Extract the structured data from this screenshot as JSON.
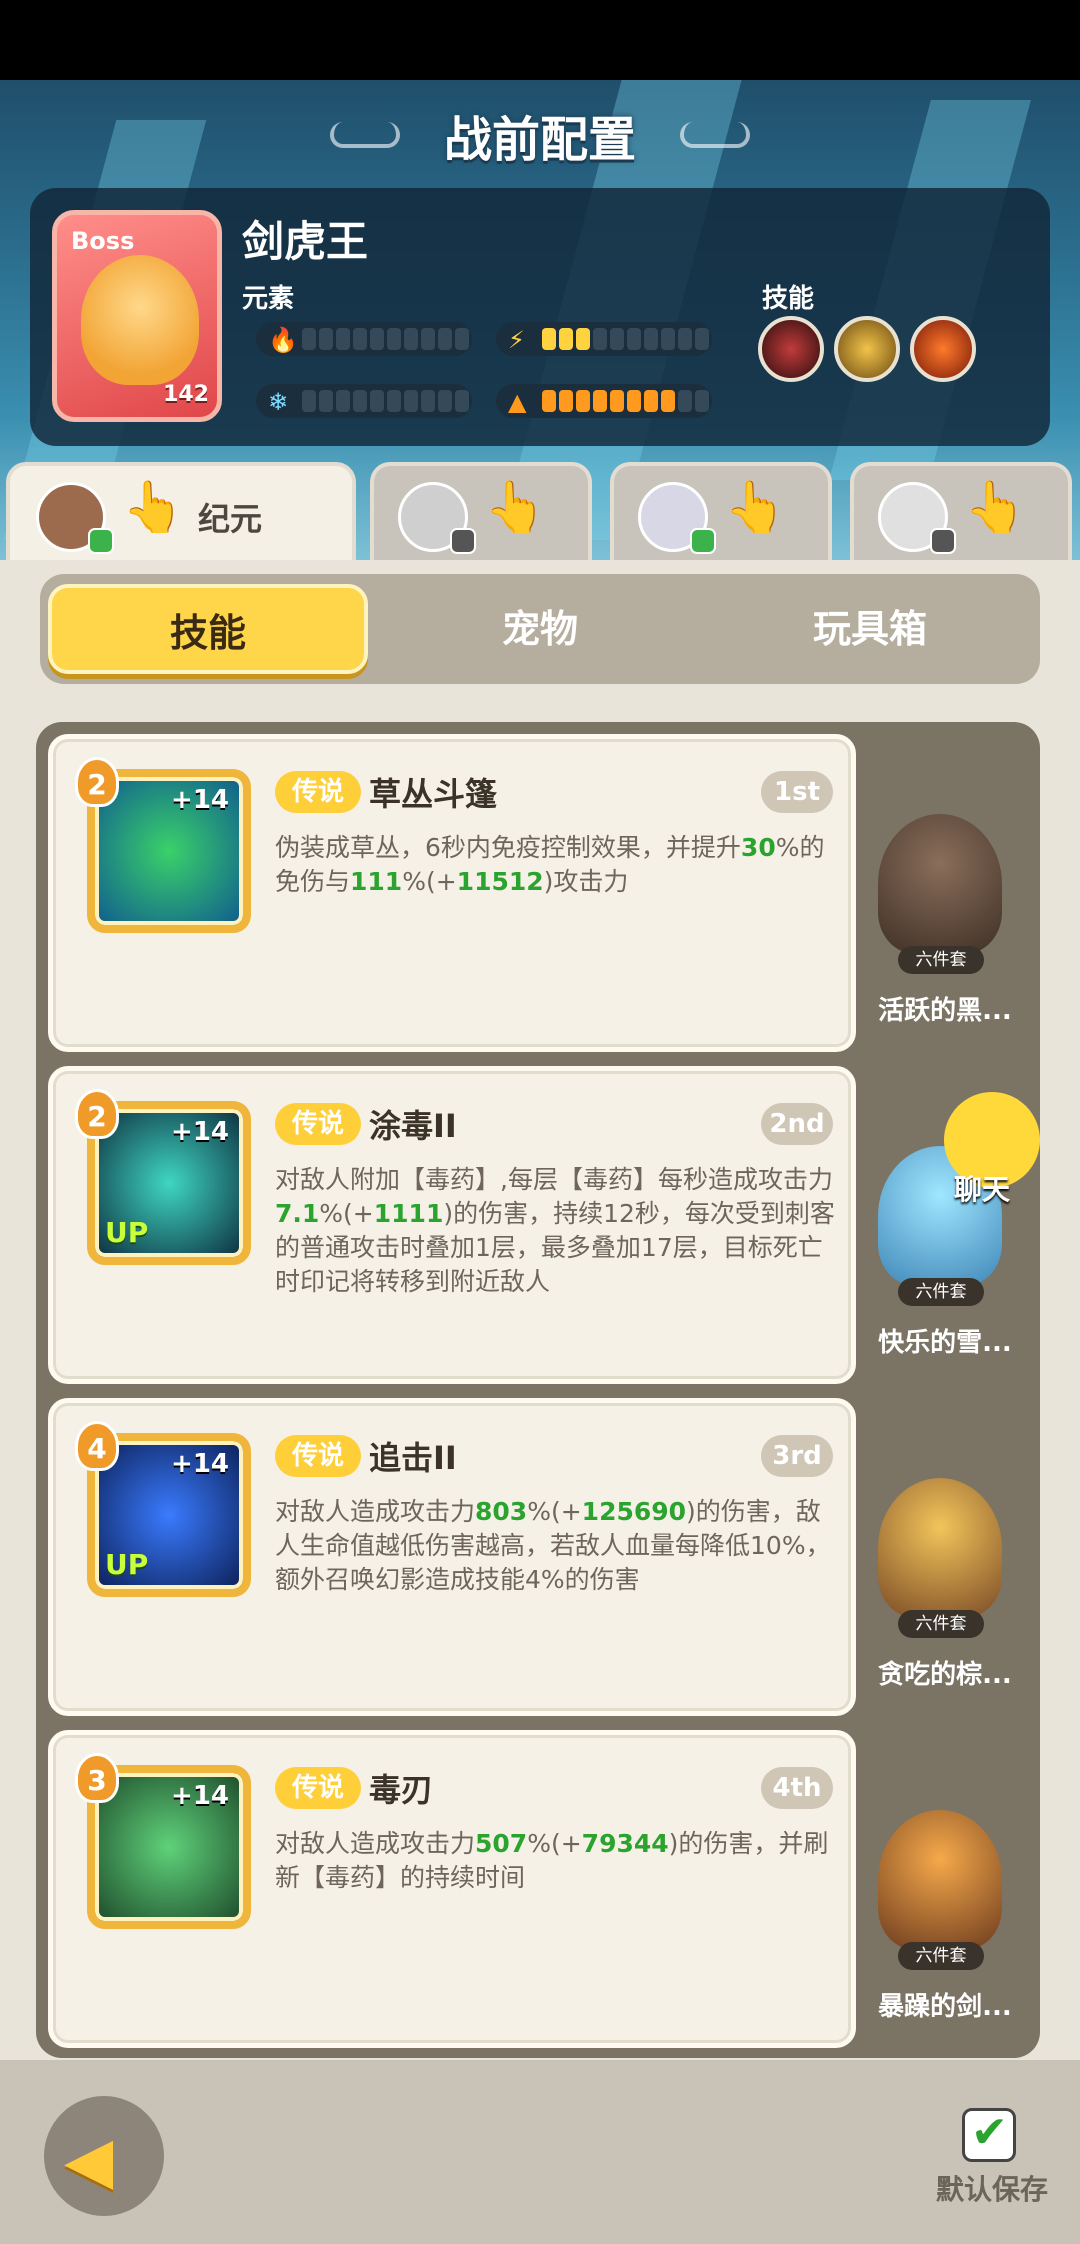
{
  "header": {
    "title": "战前配置"
  },
  "boss": {
    "tag": "Boss",
    "level": "142",
    "name": "剑虎王",
    "element_label": "元素",
    "skill_label": "技能",
    "colors": {
      "fire": "#ff4e3a",
      "lightning": "#ffd23f",
      "ice": "#7fdcff",
      "earth": "#ff9a1f"
    }
  },
  "char_tabs": [
    {
      "name": "纪元",
      "active": true
    },
    {
      "name": "",
      "active": false
    },
    {
      "name": "",
      "active": false
    },
    {
      "name": "",
      "active": false
    }
  ],
  "segment": {
    "skills": "技能",
    "pets": "宠物",
    "toybox": "玩具箱"
  },
  "skills": [
    {
      "level": "2",
      "plus": "+14",
      "up": "",
      "rarity": "传说",
      "name": "草丛斗篷",
      "rank": "1st",
      "desc": [
        "伪装成草丛，6秒内免疫控制效果，并提升",
        "30",
        "%的免伤与",
        "111",
        "%(+",
        "11512",
        ")攻击力"
      ]
    },
    {
      "level": "2",
      "plus": "+14",
      "up": "UP",
      "rarity": "传说",
      "name": "涂毒II",
      "rank": "2nd",
      "desc": [
        "对敌人附加【毒药】,每层【毒药】每秒造成攻击力",
        "7.1",
        "%(+",
        "1111",
        ")的伤害，持续12秒，每次受到刺客的普通攻击时叠加1层，最多叠加17层，目标死亡时印记将转移到附近敌人"
      ]
    },
    {
      "level": "4",
      "plus": "+14",
      "up": "UP",
      "rarity": "传说",
      "name": "追击II",
      "rank": "3rd",
      "desc": [
        "对敌人造成攻击力",
        "803",
        "%(+",
        "125690",
        ")的伤害，敌人生命值越低伤害越高，若敌人血量每降低10%，额外召唤幻影造成技能4%的伤害"
      ]
    },
    {
      "level": "3",
      "plus": "+14",
      "up": "",
      "rarity": "传说",
      "name": "毒刃",
      "rank": "4th",
      "desc": [
        "对敌人造成攻击力",
        "507",
        "%(+",
        "79344",
        ")的伤害，并刷新【毒药】的持续时间"
      ]
    }
  ],
  "pets": [
    {
      "name": "活跃的黑...",
      "set": "六件套"
    },
    {
      "name": "快乐的雪...",
      "set": "六件套"
    },
    {
      "name": "贪吃的棕...",
      "set": "六件套"
    },
    {
      "name": "暴躁的剑...",
      "set": "六件套"
    }
  ],
  "chat": {
    "label": "聊天"
  },
  "footer": {
    "save_label": "默认保存"
  }
}
